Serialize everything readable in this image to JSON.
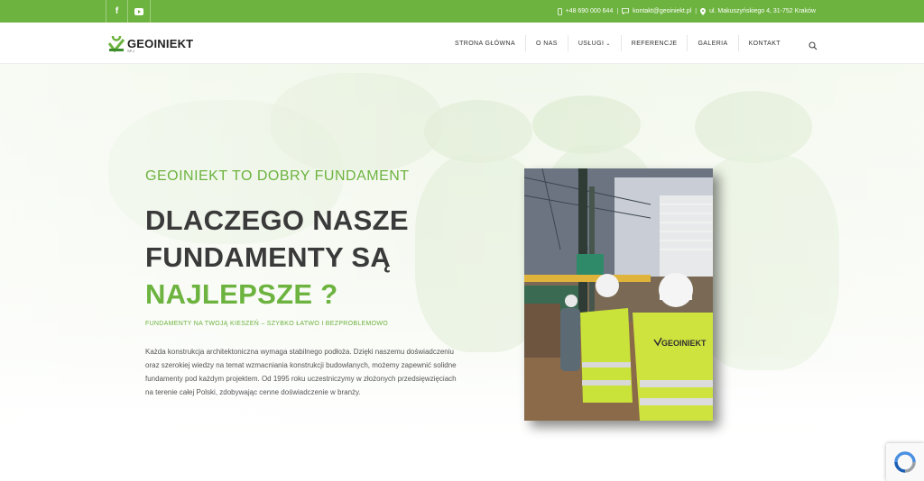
{
  "topbar": {
    "social": [
      {
        "icon": "facebook-icon",
        "label": "f"
      },
      {
        "icon": "youtube-icon",
        "label": "▶"
      }
    ],
    "phone": "+48 690 000 644",
    "email": "kontakt@geoiniekt.pl",
    "address": "ul. Makuszyńskiego 4, 31-752 Kraków",
    "separator": "|"
  },
  "nav": {
    "logo_text": "GEOINIEKT",
    "logo_sub": "SP.J",
    "items": [
      {
        "label": "STRONA GŁÓWNA"
      },
      {
        "label": "O NAS"
      },
      {
        "label": "USŁUGI"
      },
      {
        "label": "REFERENCJE"
      },
      {
        "label": "GALERIA"
      },
      {
        "label": "KONTAKT"
      }
    ]
  },
  "hero": {
    "eyebrow": "GEOINIEKT TO DOBRY FUNDAMENT",
    "heading_line1": "DLACZEGO NASZE",
    "heading_line2": "FUNDAMENTY SĄ",
    "heading_line3": "NAJLEPSZE ?",
    "tagline": "FUNDAMENTY NA TWOJĄ KIESZEŃ – SZYBKO ŁATWO I BEZPROBLEMOWO",
    "paragraph": "Każda konstrukcja architektoniczna wymaga stabilnego podłoża. Dzięki naszemu doświadczeniu oraz szerokiej wiedzy na temat wzmacniania konstrukcji budowlanych, możemy zapewnić solidne fundamenty pod każdym projektem. Od 1995 roku uczestniczymy w złożonych przedsięwzięciach na terenie całej Polski, zdobywając cenne doświadczenie w branży.",
    "photo_vest_text": "GEOINIEKT"
  },
  "colors": {
    "brand_green": "#6db33f",
    "heading_dark": "#3a3a3a"
  }
}
